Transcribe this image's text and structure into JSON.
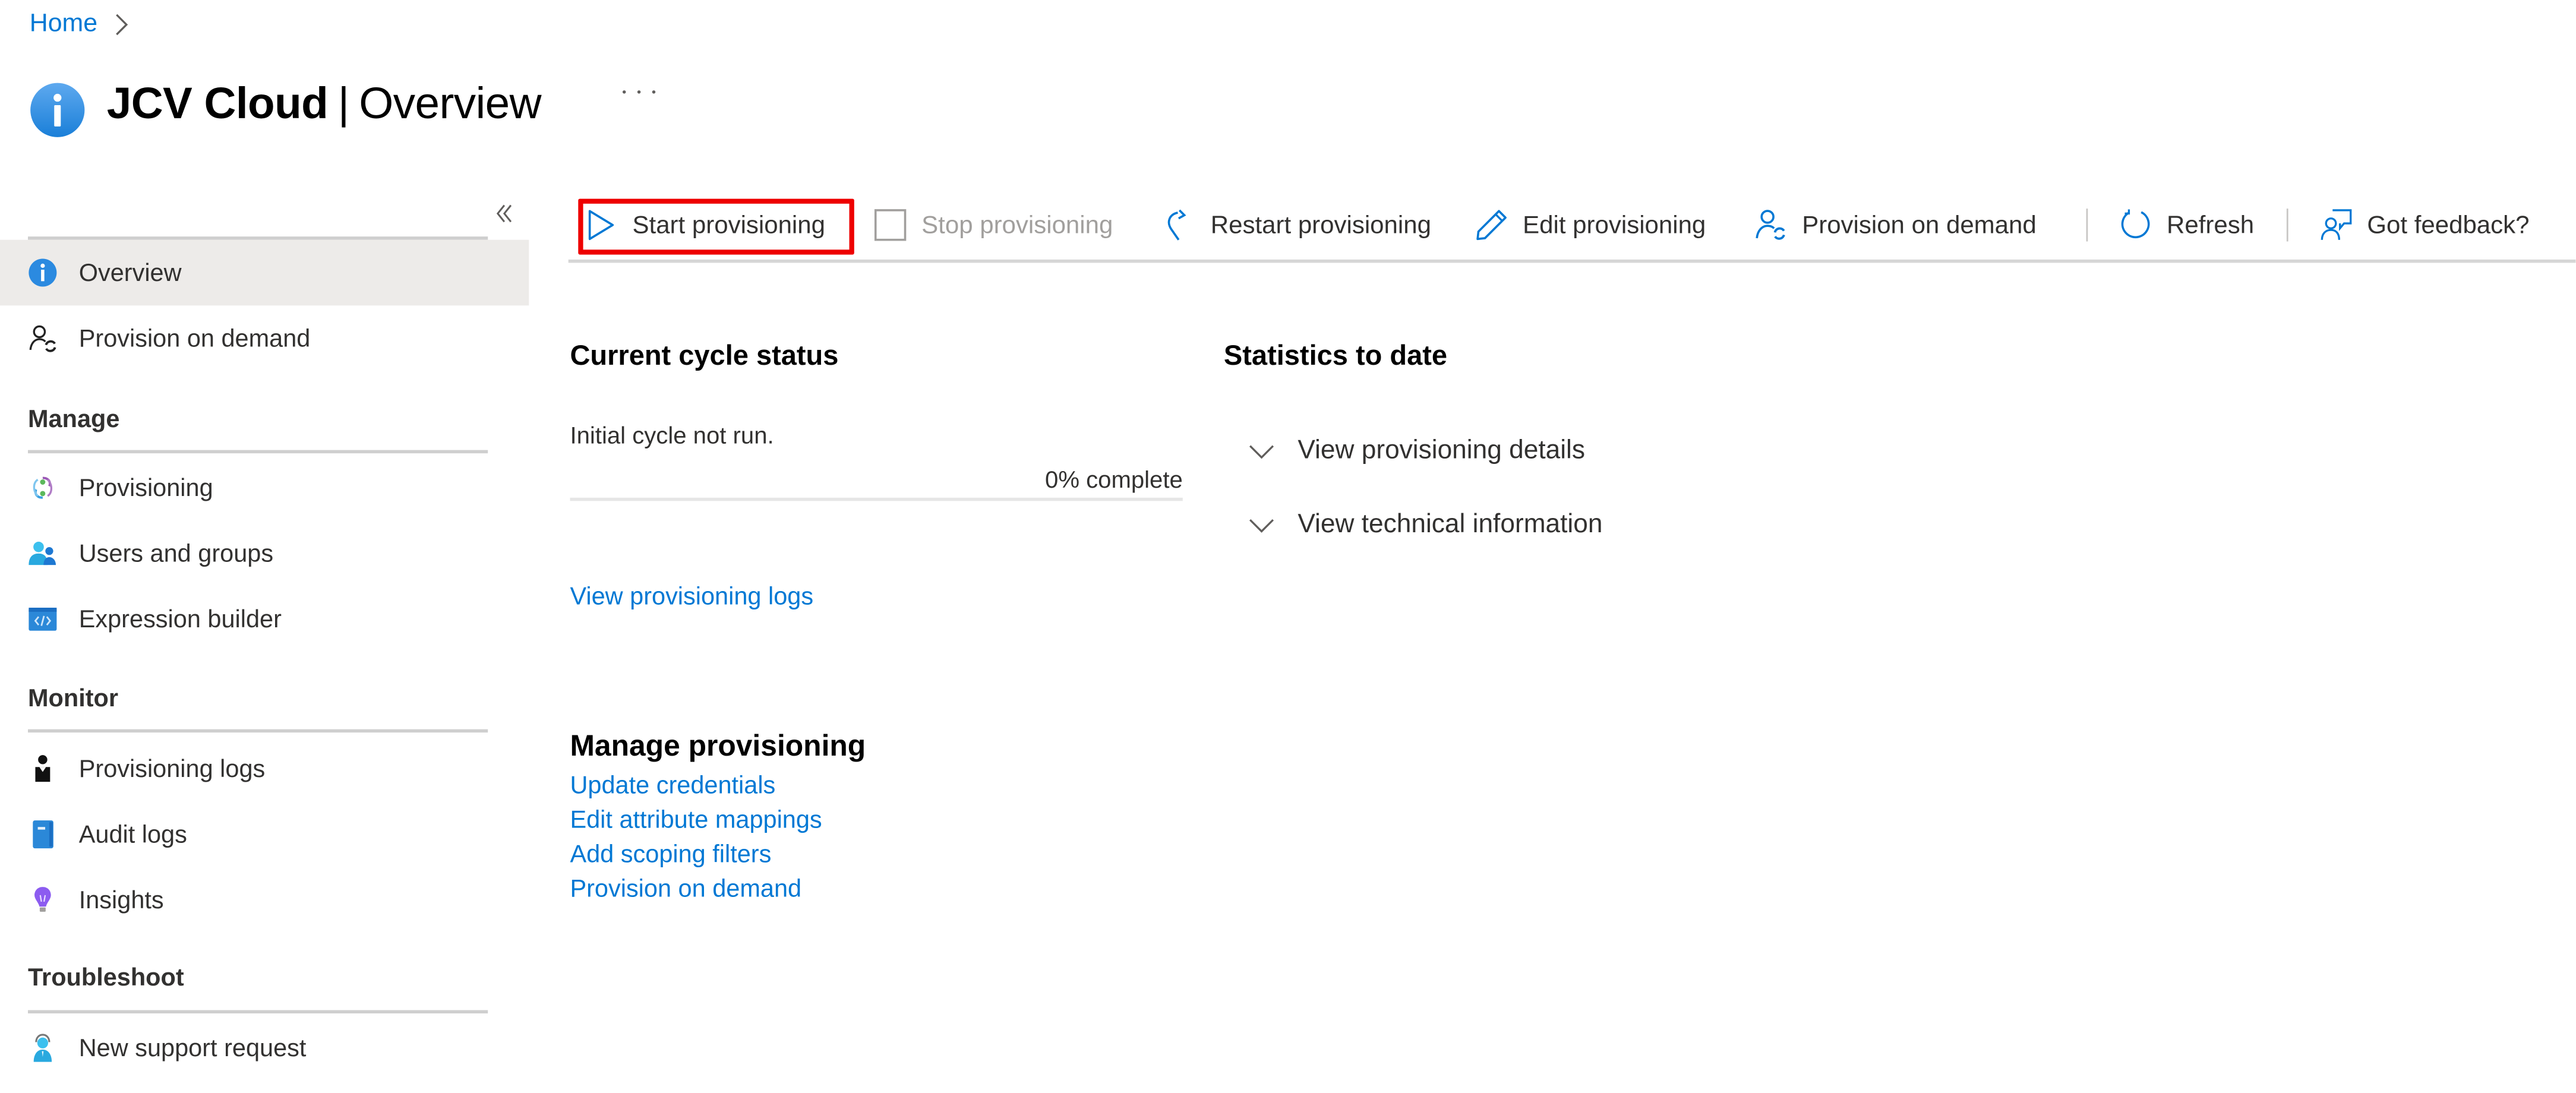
{
  "breadcrumb": {
    "items": [
      "Home"
    ],
    "separator_icon": "chevron-right-icon"
  },
  "header": {
    "app_name": "JCV Cloud",
    "separator": "|",
    "page_name": "Overview",
    "icon": "info-icon",
    "more_icon": "more-ellipsis-icon"
  },
  "sidebar": {
    "collapse_icon": "double-chevron-left-icon",
    "top_items": [
      {
        "label": "Overview",
        "icon": "info-icon",
        "active": true
      },
      {
        "label": "Provision on demand",
        "icon": "user-sync-icon",
        "active": false
      }
    ],
    "groups": [
      {
        "label": "Manage",
        "items": [
          {
            "label": "Provisioning",
            "icon": "provisioning-cycle-icon"
          },
          {
            "label": "Users and groups",
            "icon": "users-groups-icon"
          },
          {
            "label": "Expression builder",
            "icon": "code-window-icon"
          }
        ]
      },
      {
        "label": "Monitor",
        "items": [
          {
            "label": "Provisioning logs",
            "icon": "person-log-icon"
          },
          {
            "label": "Audit logs",
            "icon": "book-icon"
          },
          {
            "label": "Insights",
            "icon": "lightbulb-icon"
          }
        ]
      },
      {
        "label": "Troubleshoot",
        "items": [
          {
            "label": "New support request",
            "icon": "support-agent-icon"
          }
        ]
      }
    ]
  },
  "toolbar": {
    "buttons": [
      {
        "label": "Start provisioning",
        "icon": "play-icon",
        "enabled": true,
        "highlighted": true
      },
      {
        "label": "Stop provisioning",
        "icon": "stop-square-icon",
        "enabled": false
      },
      {
        "label": "Restart provisioning",
        "icon": "restart-arrow-icon",
        "enabled": true
      },
      {
        "label": "Edit provisioning",
        "icon": "pencil-icon",
        "enabled": true
      },
      {
        "label": "Provision on demand",
        "icon": "user-sync-icon",
        "enabled": true
      },
      {
        "label": "Refresh",
        "icon": "refresh-icon",
        "enabled": true
      },
      {
        "label": "Got feedback?",
        "icon": "feedback-icon",
        "enabled": true
      }
    ],
    "highlight_color": "#ee0000"
  },
  "current_cycle": {
    "title": "Current cycle status",
    "status_text": "Initial cycle not run.",
    "progress_percent": 0,
    "progress_label": "0% complete",
    "logs_link": "View provisioning logs"
  },
  "statistics": {
    "title": "Statistics to date",
    "expanders": [
      {
        "label": "View provisioning details",
        "expanded": false
      },
      {
        "label": "View technical information",
        "expanded": false
      }
    ]
  },
  "manage_provisioning": {
    "title": "Manage provisioning",
    "links": [
      "Update credentials",
      "Edit attribute mappings",
      "Add scoping filters",
      "Provision on demand"
    ]
  },
  "colors": {
    "accent": "#0078d4",
    "text": "#323130",
    "disabled_text": "#a19f9d",
    "active_nav_bg": "#edebe9"
  }
}
